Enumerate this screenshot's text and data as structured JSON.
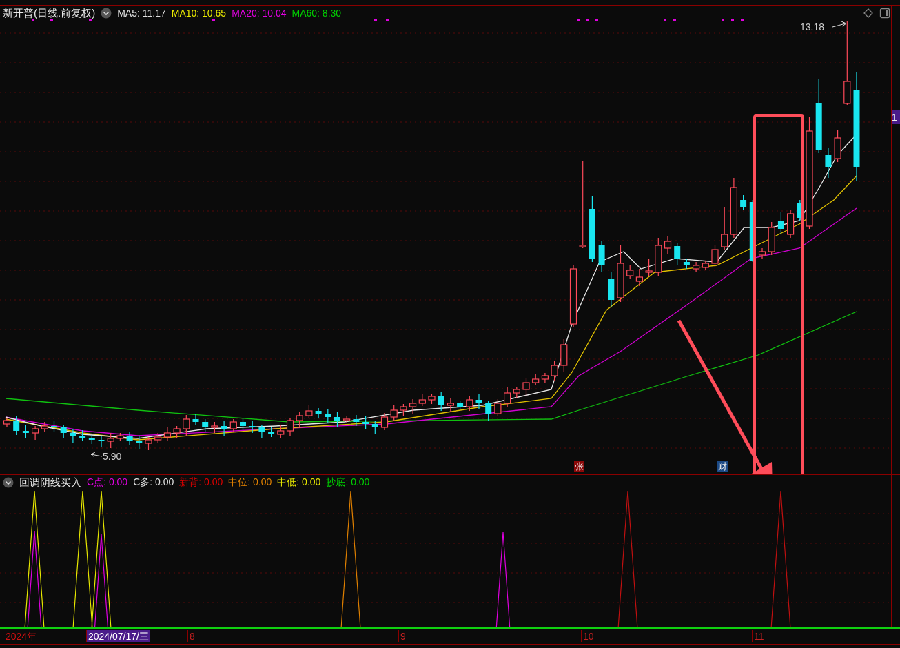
{
  "header": {
    "title": "新开普(日线.前复权)",
    "indicators": [
      {
        "label": "MA5: 11.17",
        "color": "#e0e0e0"
      },
      {
        "label": "MA10: 10.65",
        "color": "#e8e800"
      },
      {
        "label": "MA20: 10.04",
        "color": "#e000e0"
      },
      {
        "label": "MA60: 8.30",
        "color": "#00d000"
      }
    ]
  },
  "price_chart": {
    "high_label": "13.18",
    "low_label": "5.90",
    "right_axis_label": "1",
    "event_marks": [
      {
        "text": "张",
        "color": "#8b0a0a"
      },
      {
        "text": "财",
        "color": "#1c4a86"
      }
    ]
  },
  "indicator_panel": {
    "title": "回调阴线买入",
    "values": [
      {
        "label": "C点: 0.00",
        "color": "#e000e0"
      },
      {
        "label": "C多: 0.00",
        "color": "#e0e0e0"
      },
      {
        "label": "新背: 0.00",
        "color": "#e00000"
      },
      {
        "label": "中位: 0.00",
        "color": "#e08000"
      },
      {
        "label": "中低: 0.00",
        "color": "#e8e800"
      },
      {
        "label": "抄底: 0.00",
        "color": "#00d000"
      }
    ]
  },
  "time_axis": [
    {
      "label": "2024年",
      "kind": "year"
    },
    {
      "label": "2024/07/17/三",
      "kind": "cursor"
    },
    {
      "label": "8",
      "kind": "month"
    },
    {
      "label": "9",
      "kind": "month"
    },
    {
      "label": "10",
      "kind": "month"
    },
    {
      "label": "11",
      "kind": "month"
    }
  ]
}
